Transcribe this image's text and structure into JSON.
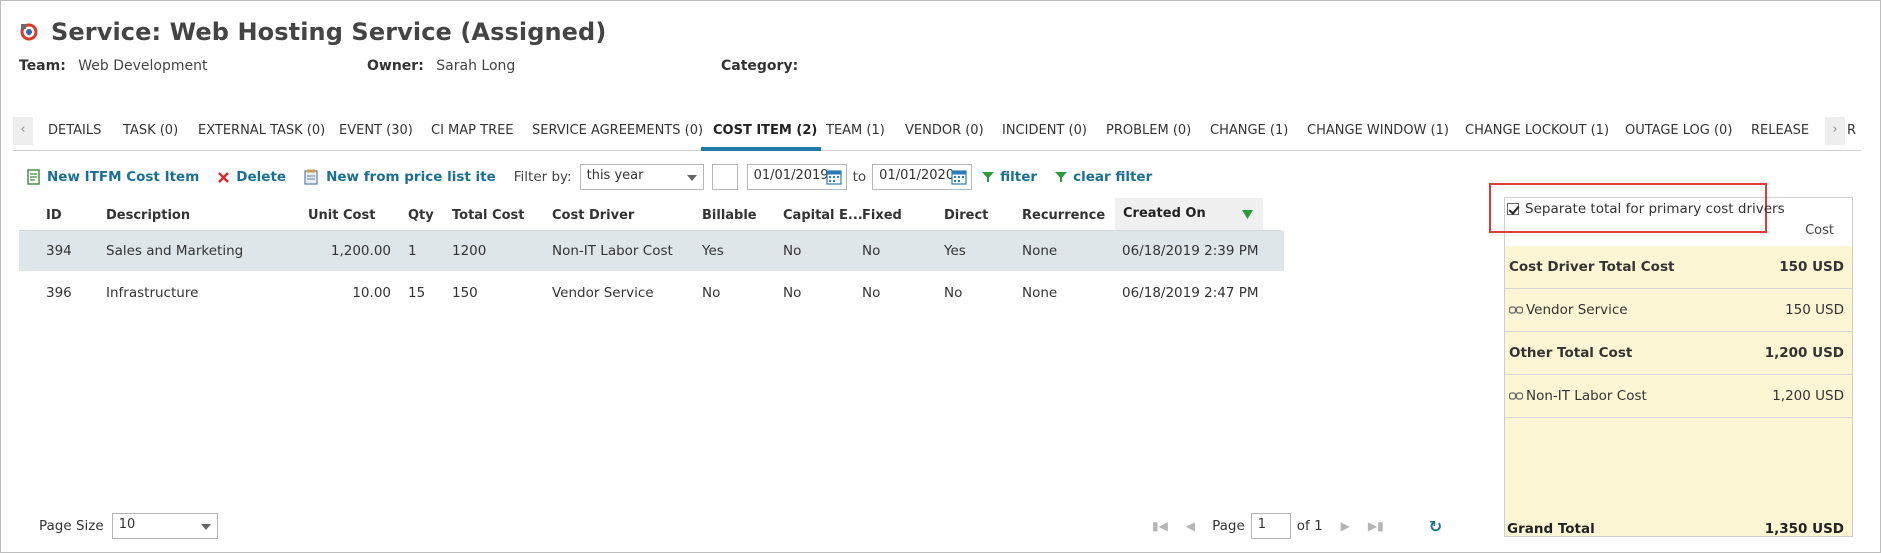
{
  "header": {
    "title": "Service: Web Hosting Service (Assigned)",
    "team_label": "Team:",
    "team_value": "Web Development",
    "owner_label": "Owner:",
    "owner_value": "Sarah Long",
    "category_label": "Category:",
    "category_value": ""
  },
  "tabs": [
    {
      "label": "DETAILS"
    },
    {
      "label": "TASK (0)"
    },
    {
      "label": "EXTERNAL TASK (0)"
    },
    {
      "label": "EVENT (30)"
    },
    {
      "label": "CI MAP TREE"
    },
    {
      "label": "SERVICE AGREEMENTS (0)"
    },
    {
      "label": "COST ITEM (2)"
    },
    {
      "label": "TEAM (1)"
    },
    {
      "label": "VENDOR (0)"
    },
    {
      "label": "INCIDENT (0)"
    },
    {
      "label": "PROBLEM (0)"
    },
    {
      "label": "CHANGE (1)"
    },
    {
      "label": "CHANGE WINDOW (1)"
    },
    {
      "label": "CHANGE LOCKOUT (1)"
    },
    {
      "label": "OUTAGE LOG (0)"
    },
    {
      "label": "RELEASE"
    },
    {
      "label": "R"
    }
  ],
  "toolbar": {
    "new_item": "New ITFM Cost Item",
    "delete": "Delete",
    "new_from_price": "New from price list ite",
    "filter_by_label": "Filter by:",
    "filter_value": "this year",
    "date_from": "01/01/2019",
    "to_label": "to",
    "date_to": "01/01/2020",
    "filter": "filter",
    "clear_filter": "clear filter"
  },
  "grid": {
    "columns": [
      "ID",
      "Description",
      "Unit Cost",
      "Qty",
      "Total Cost",
      "Cost Driver",
      "Billable",
      "Capital E...",
      "Fixed",
      "Direct",
      "Recurrence",
      "Created On"
    ],
    "rows": [
      {
        "id": "394",
        "description": "Sales and Marketing",
        "unit_cost": "1,200.00",
        "qty": "1",
        "total_cost": "1200",
        "cost_driver": "Non-IT Labor Cost",
        "billable": "Yes",
        "capital": "No",
        "fixed": "No",
        "direct": "Yes",
        "recurrence": "None",
        "created_on": "06/18/2019 2:39 PM"
      },
      {
        "id": "396",
        "description": "Infrastructure",
        "unit_cost": "10.00",
        "qty": "15",
        "total_cost": "150",
        "cost_driver": "Vendor Service",
        "billable": "No",
        "capital": "No",
        "fixed": "No",
        "direct": "No",
        "recurrence": "None",
        "created_on": "06/18/2019 2:47 PM"
      }
    ]
  },
  "pager": {
    "page_size_label": "Page Size",
    "page_size": "10",
    "page_label": "Page",
    "page_value": "1",
    "of_label": "of 1"
  },
  "panel": {
    "checkbox_label": "Separate total for primary cost drivers",
    "cost_header": "Cost",
    "rows": [
      {
        "label": "Cost Driver Total Cost",
        "value": "150 USD"
      },
      {
        "label": "Vendor Service",
        "value": "150 USD"
      },
      {
        "label": "Other Total Cost",
        "value": "1,200 USD"
      },
      {
        "label": "Non-IT Labor Cost",
        "value": "1,200 USD"
      }
    ],
    "grand_label": "Grand Total",
    "grand_value": "1,350 USD"
  },
  "colors": {
    "accent": "#1d7ba6",
    "link": "#1b6f94",
    "highlight": "#e23a3a",
    "panel_bg": "#fcf6d4",
    "selected_row": "#dfe6ea"
  }
}
